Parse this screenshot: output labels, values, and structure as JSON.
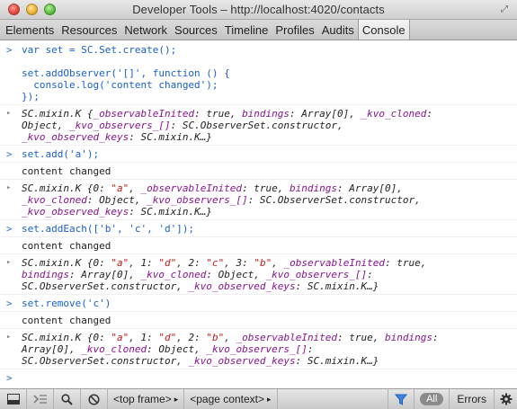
{
  "window": {
    "title": "Developer Tools – http://localhost:4020/contacts"
  },
  "tabs": [
    {
      "label": "Elements"
    },
    {
      "label": "Resources"
    },
    {
      "label": "Network"
    },
    {
      "label": "Sources"
    },
    {
      "label": "Timeline"
    },
    {
      "label": "Profiles"
    },
    {
      "label": "Audits"
    },
    {
      "label": "Console",
      "active": true
    }
  ],
  "console": {
    "entries": [
      {
        "type": "input",
        "text": "var set = SC.Set.create();\n\nset.addObserver('[]', function () {\n  console.log('content changed');\n});"
      },
      {
        "type": "result",
        "parts": [
          [
            "v",
            "SC.mixin.K {"
          ],
          [
            "k",
            "_observableInited"
          ],
          [
            "v",
            ": true, "
          ],
          [
            "k",
            "bindings"
          ],
          [
            "v",
            ": Array[0], "
          ],
          [
            "k",
            "_kvo_cloned"
          ],
          [
            "v",
            ":\nObject, "
          ],
          [
            "k",
            "_kvo_observers_[]"
          ],
          [
            "v",
            ": SC.ObserverSet.constructor,\n"
          ],
          [
            "k",
            "_kvo_observed_keys"
          ],
          [
            "v",
            ": SC.mixin.K…}"
          ]
        ]
      },
      {
        "type": "input",
        "text": "set.add('a');"
      },
      {
        "type": "log",
        "text": "content changed"
      },
      {
        "type": "result",
        "parts": [
          [
            "v",
            "SC.mixin.K {0: "
          ],
          [
            "s",
            "\"a\""
          ],
          [
            "v",
            ", "
          ],
          [
            "k",
            "_observableInited"
          ],
          [
            "v",
            ": true, "
          ],
          [
            "k",
            "bindings"
          ],
          [
            "v",
            ": Array[0],\n"
          ],
          [
            "k",
            "_kvo_cloned"
          ],
          [
            "v",
            ": Object, "
          ],
          [
            "k",
            "_kvo_observers_[]"
          ],
          [
            "v",
            ": SC.ObserverSet.constructor,\n"
          ],
          [
            "k",
            "_kvo_observed_keys"
          ],
          [
            "v",
            ": SC.mixin.K…}"
          ]
        ]
      },
      {
        "type": "input",
        "text": "set.addEach(['b', 'c', 'd']);"
      },
      {
        "type": "log",
        "text": "content changed"
      },
      {
        "type": "result",
        "parts": [
          [
            "v",
            "SC.mixin.K {0: "
          ],
          [
            "s",
            "\"a\""
          ],
          [
            "v",
            ", 1: "
          ],
          [
            "s",
            "\"d\""
          ],
          [
            "v",
            ", 2: "
          ],
          [
            "s",
            "\"c\""
          ],
          [
            "v",
            ", 3: "
          ],
          [
            "s",
            "\"b\""
          ],
          [
            "v",
            ", "
          ],
          [
            "k",
            "_observableInited"
          ],
          [
            "v",
            ": true,\n"
          ],
          [
            "k",
            "bindings"
          ],
          [
            "v",
            ": Array[0], "
          ],
          [
            "k",
            "_kvo_cloned"
          ],
          [
            "v",
            ": Object, "
          ],
          [
            "k",
            "_kvo_observers_[]"
          ],
          [
            "v",
            ":\nSC.ObserverSet.constructor, "
          ],
          [
            "k",
            "_kvo_observed_keys"
          ],
          [
            "v",
            ": SC.mixin.K…}"
          ]
        ]
      },
      {
        "type": "input",
        "text": "set.remove('c')"
      },
      {
        "type": "log",
        "text": "content changed"
      },
      {
        "type": "result",
        "parts": [
          [
            "v",
            "SC.mixin.K {0: "
          ],
          [
            "s",
            "\"a\""
          ],
          [
            "v",
            ", 1: "
          ],
          [
            "s",
            "\"d\""
          ],
          [
            "v",
            ", 2: "
          ],
          [
            "s",
            "\"b\""
          ],
          [
            "v",
            ", "
          ],
          [
            "k",
            "_observableInited"
          ],
          [
            "v",
            ": true, "
          ],
          [
            "k",
            "bindings"
          ],
          [
            "v",
            ":\nArray[0], "
          ],
          [
            "k",
            "_kvo_cloned"
          ],
          [
            "v",
            ": Object, "
          ],
          [
            "k",
            "_kvo_observers_[]"
          ],
          [
            "v",
            ":\nSC.ObserverSet.constructor, "
          ],
          [
            "k",
            "_kvo_observed_keys"
          ],
          [
            "v",
            ": SC.mixin.K…}"
          ]
        ]
      }
    ]
  },
  "statusbar": {
    "frame_select": "<top frame>",
    "context_select": "<page context>",
    "filter_all": "All",
    "errors_label": "Errors"
  },
  "colors": {
    "input_text": "#1a5fd0",
    "object_key": "#881391",
    "string_value": "#c41a16"
  }
}
